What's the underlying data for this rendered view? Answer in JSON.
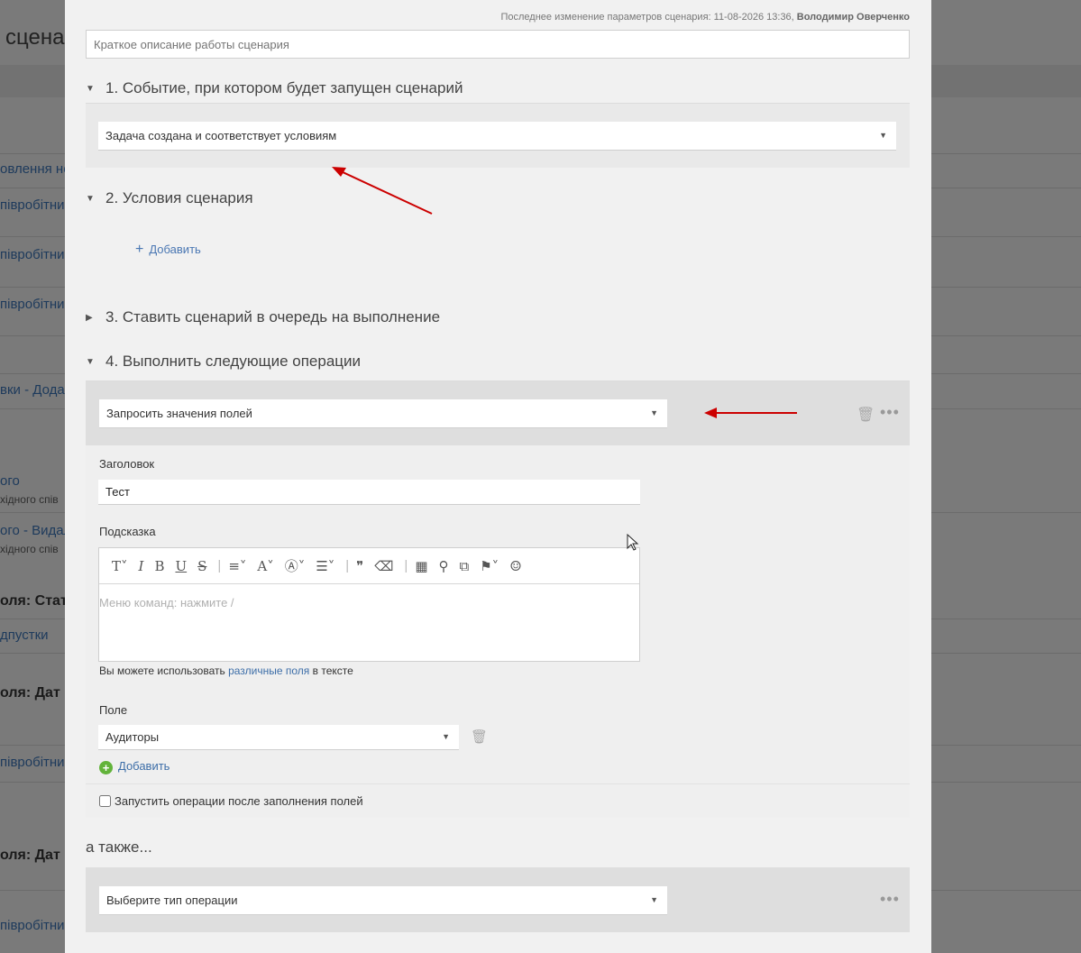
{
  "background": {
    "header_fragment": "сцена",
    "rows": [
      {
        "text": "овлення не",
        "kind": "link"
      },
      {
        "text": "півробітника",
        "kind": "link"
      },
      {
        "text": "півробітника",
        "kind": "link"
      },
      {
        "text": "півробітника",
        "kind": "link"
      },
      {
        "text": "вки - Додав",
        "kind": "link"
      },
      {
        "text": "ого",
        "kind": "link"
      },
      {
        "text": "хідного спів",
        "kind": "sub"
      },
      {
        "text": "ого - Видал",
        "kind": "link"
      },
      {
        "text": "хідного спів",
        "kind": "sub"
      },
      {
        "text": "оля: Стат",
        "kind": "bold"
      },
      {
        "text": "дпустки",
        "kind": "link"
      },
      {
        "text": "оля: Дат",
        "kind": "bold"
      },
      {
        "text": "півробітника",
        "kind": "link"
      },
      {
        "text": "оля: Дат",
        "kind": "bold"
      },
      {
        "text": "півробітника",
        "kind": "link"
      }
    ]
  },
  "modal": {
    "last_modified_prefix": "Последнее изменение параметров сценария: 11-08-2026 13:36,",
    "last_modified_user": "Володимир Оверченко",
    "description_placeholder": "Краткое описание работы сценария",
    "section1": {
      "title": "1. Событие, при котором будет запущен сценарий",
      "event_value": "Задача создана и соответствует условиям"
    },
    "section2": {
      "title": "2. Условия сценария",
      "add_label": "Добавить"
    },
    "section3": {
      "title": "3. Ставить сценарий в очередь на выполнение"
    },
    "section4": {
      "title": "4. Выполнить следующие операции",
      "operation_value": "Запросить значения полей",
      "heading_label": "Заголовок",
      "heading_value": "Тест",
      "hint_label": "Подсказка",
      "editor_placeholder": "Меню команд: нажмите /",
      "hint_text_before": "Вы можете использовать",
      "hint_link": "различные поля",
      "hint_text_after": "в тексте",
      "field_label": "Поле",
      "field_value": "Аудиторы",
      "add_field_label": "Добавить",
      "run_after_label": "Запустить операции после заполнения полей",
      "run_after_checked": false
    },
    "also": {
      "title": "а также...",
      "select_placeholder": "Выберите тип операции"
    }
  },
  "colors": {
    "accent_link": "#4a77b3",
    "add_green": "#62b33a",
    "annotation_arrow": "#cc0000"
  },
  "toolbar_icons": [
    "text-size-icon",
    "italic-icon",
    "bold-icon",
    "underline-icon",
    "strikethrough-icon",
    "align-icon",
    "font-color-icon",
    "highlight-icon",
    "list-icon",
    "quote-icon",
    "clear-format-icon",
    "table-icon",
    "link-icon",
    "embed-icon",
    "bookmark-icon",
    "emoji-icon"
  ]
}
